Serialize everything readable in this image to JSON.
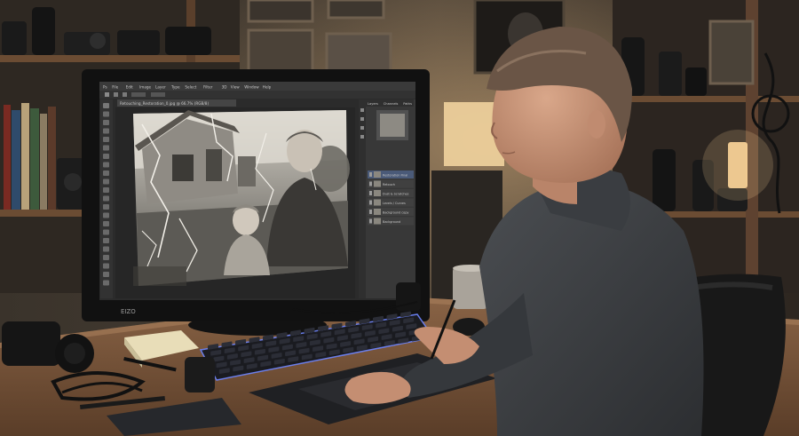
{
  "photoshop": {
    "menu": [
      "Ps",
      "File",
      "Edit",
      "Image",
      "Layer",
      "Type",
      "Select",
      "Filter",
      "3D",
      "View",
      "Window",
      "Help"
    ],
    "document_tab": "Retouching_Restoration_0.jpg @ 66.7% (RGB/8)",
    "panel_tabs": [
      "Layers",
      "Channels",
      "Paths"
    ],
    "layers": [
      {
        "name": "Restoration Final"
      },
      {
        "name": "Retouch"
      },
      {
        "name": "Dust & Scratches"
      },
      {
        "name": "Levels / Curves"
      },
      {
        "name": "Background copy"
      },
      {
        "name": "Background"
      }
    ]
  },
  "monitor": {
    "brand": "EIZO"
  },
  "colors": {
    "screen_bg": "#2b2b2b",
    "ps_panel": "#383838",
    "keyboard_glow": "#6f86ff",
    "lamp": "#ffd79a"
  }
}
